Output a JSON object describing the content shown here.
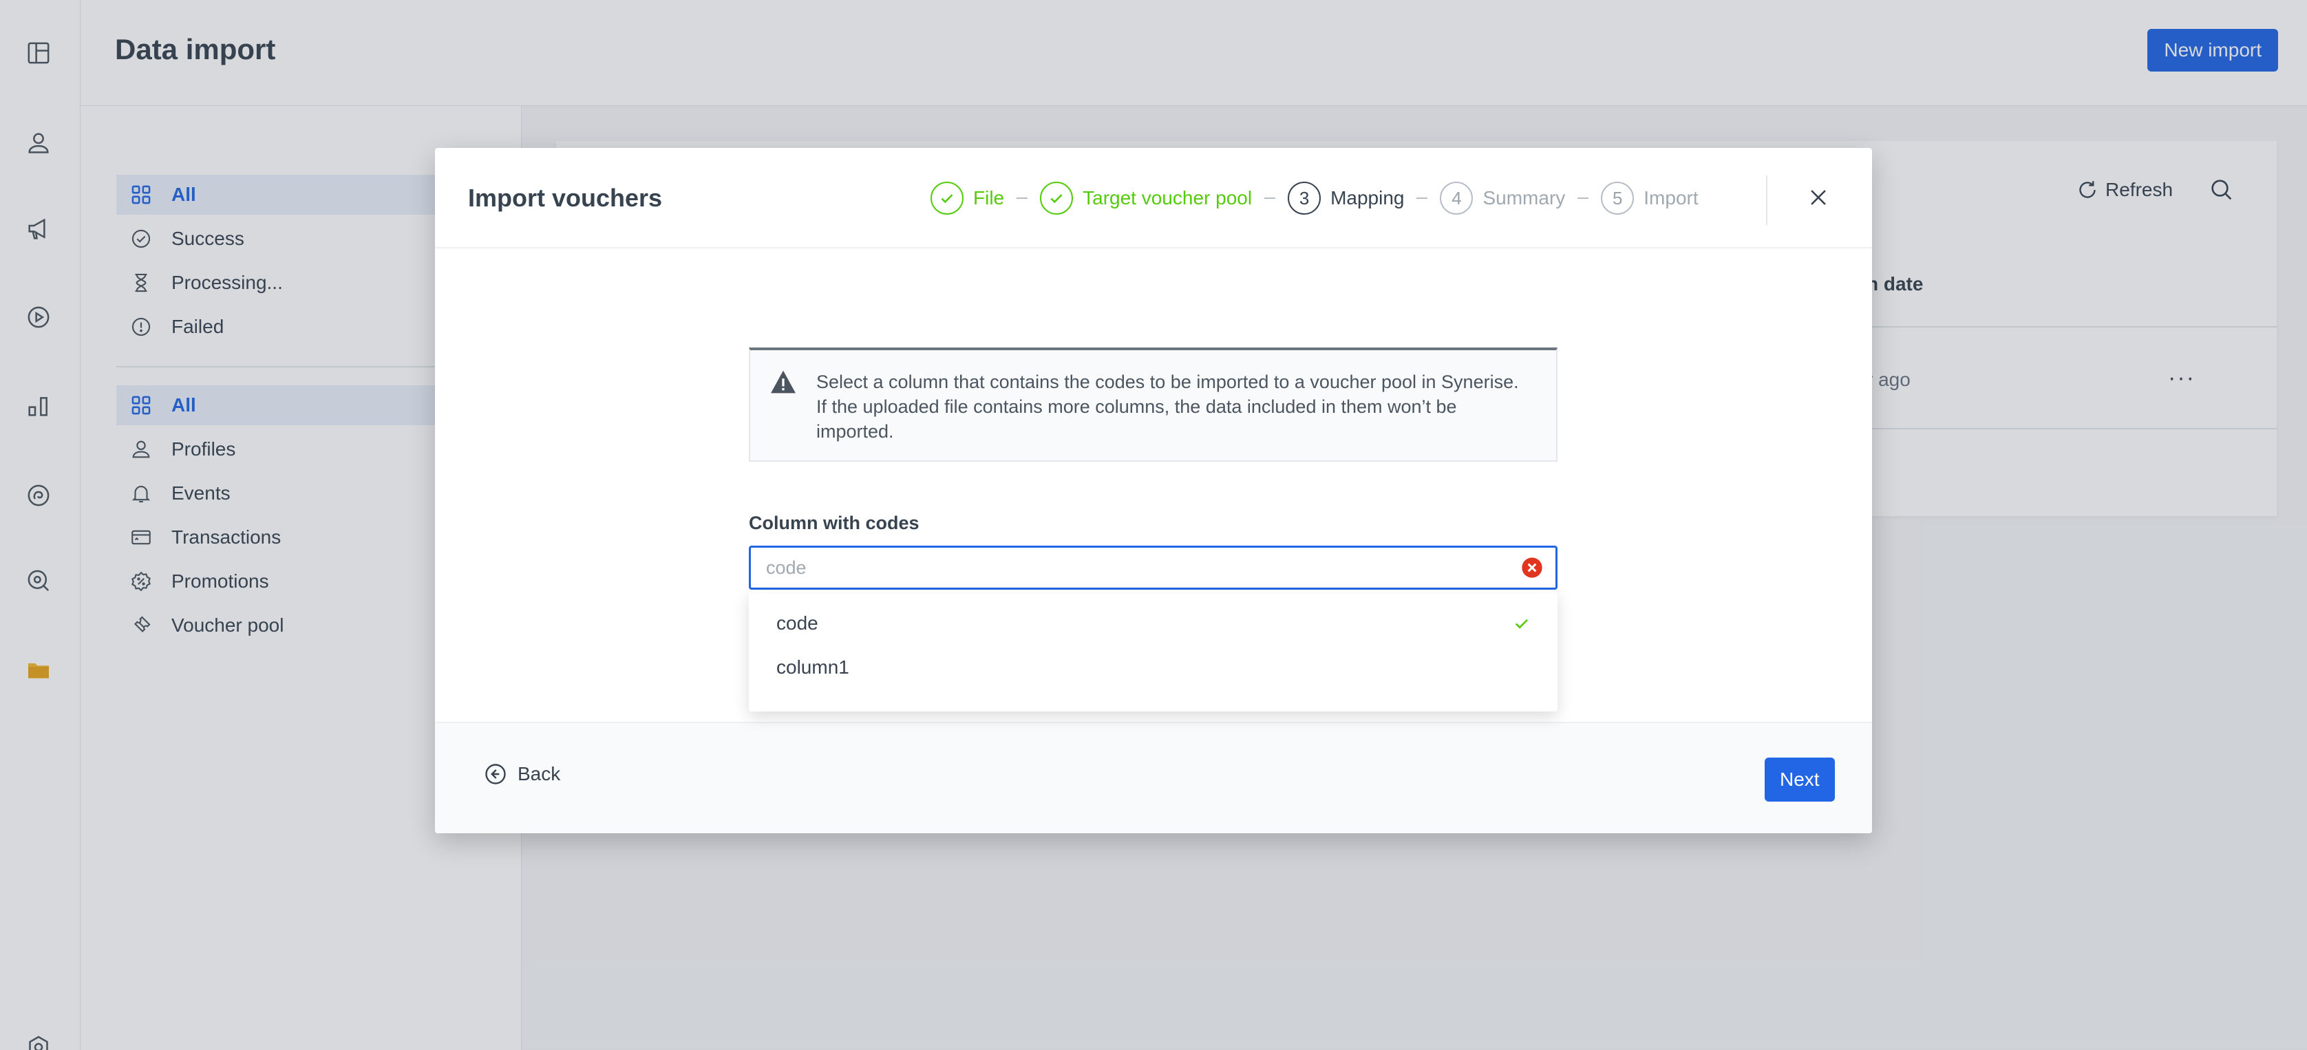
{
  "header": {
    "title": "Data import",
    "new_import_label": "New import"
  },
  "rail": {
    "icons": [
      "layout-icon",
      "user-icon",
      "megaphone-icon",
      "play-icon",
      "chart-icon",
      "ai-icon",
      "search-settings-icon",
      "folder-icon",
      "settings-icon"
    ]
  },
  "sidebar": {
    "group1": [
      {
        "label": "All",
        "icon": "grid-icon",
        "active": true
      },
      {
        "label": "Success",
        "icon": "check-circle-icon"
      },
      {
        "label": "Processing...",
        "icon": "hourglass-icon"
      },
      {
        "label": "Failed",
        "icon": "alert-circle-icon"
      }
    ],
    "group2": [
      {
        "label": "All",
        "icon": "grid-icon",
        "active": true
      },
      {
        "label": "Profiles",
        "icon": "user-icon"
      },
      {
        "label": "Events",
        "icon": "bell-icon"
      },
      {
        "label": "Transactions",
        "icon": "card-icon"
      },
      {
        "label": "Promotions",
        "icon": "percent-icon"
      },
      {
        "label": "Voucher pool",
        "icon": "ticket-icon"
      }
    ]
  },
  "background": {
    "refresh_label": "Refresh",
    "column_date": "n date",
    "row_ago": "r ago",
    "row_more": "···"
  },
  "modal": {
    "title": "Import vouchers",
    "steps": [
      {
        "number": "1",
        "label": "File",
        "state": "done"
      },
      {
        "number": "2",
        "label": "Target voucher pool",
        "state": "done"
      },
      {
        "number": "3",
        "label": "Mapping",
        "state": "current"
      },
      {
        "number": "4",
        "label": "Summary",
        "state": "todo"
      },
      {
        "number": "5",
        "label": "Import",
        "state": "todo"
      }
    ],
    "info_text": "Select a column that contains the codes to be imported to a voucher pool in Synerise. If the uploaded file contains more columns, the data included in them won’t be imported.",
    "field_label": "Column with codes",
    "field_placeholder": "code",
    "options": [
      {
        "label": "code",
        "selected": true
      },
      {
        "label": "column1",
        "selected": false
      }
    ],
    "back_label": "Back",
    "next_label": "Next"
  },
  "colors": {
    "primary": "#2266e6",
    "success": "#54cb0b",
    "error": "#e1351f",
    "text": "#384350"
  }
}
